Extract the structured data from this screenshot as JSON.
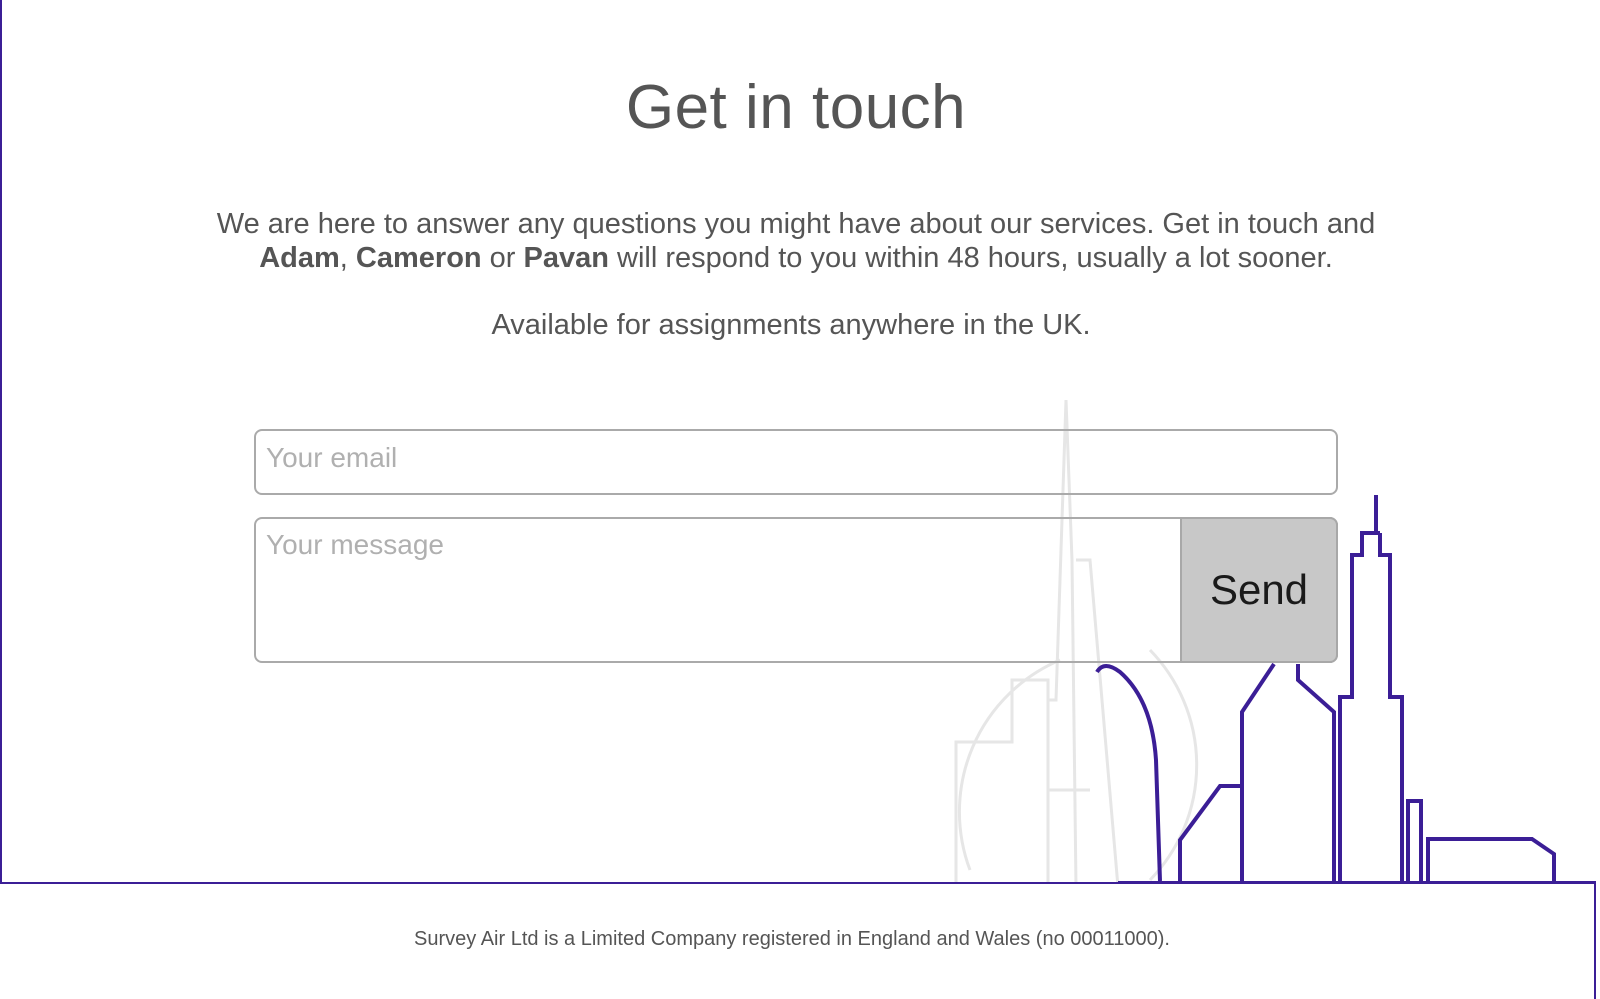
{
  "colors": {
    "accent": "#3b1e96",
    "text": "#555555",
    "button_bg": "#c8c8c8",
    "skyline_faded": "#e6e6e6"
  },
  "contact": {
    "title": "Get in touch",
    "intro_line1": "We are here to answer any questions you might have about our services. Get in touch and",
    "people": [
      "Adam",
      "Cameron",
      "Pavan"
    ],
    "sep_comma": ", ",
    "sep_or": " or ",
    "intro_line2_tail": " will respond to you within 48 hours, usually a lot sooner.",
    "availability": "Available for assignments anywhere in the UK."
  },
  "form": {
    "email_placeholder": "Your email",
    "message_placeholder": "Your message",
    "send_label": "Send"
  },
  "footer": {
    "company_note": "Survey Air Ltd is a Limited Company registered in England and Wales (no 00011000)."
  },
  "decoration": {
    "icon": "city-skyline-illustration"
  }
}
